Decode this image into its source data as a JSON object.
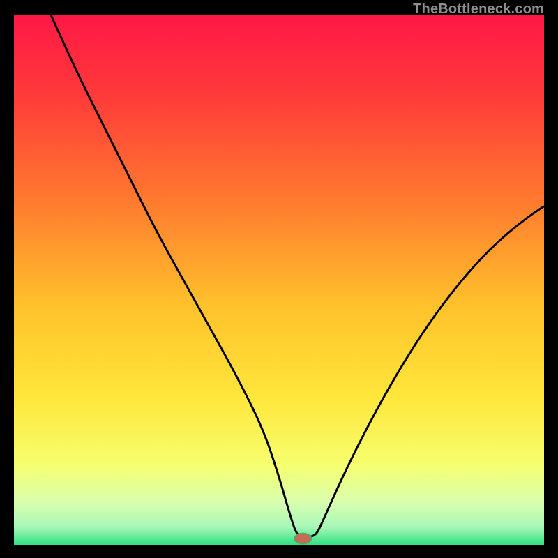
{
  "watermark": "TheBottleneck.com",
  "colors": {
    "frame": "#000000",
    "gradient_stops": [
      {
        "offset": 0.0,
        "color": "#ff1846"
      },
      {
        "offset": 0.15,
        "color": "#ff3a3a"
      },
      {
        "offset": 0.35,
        "color": "#ff7a2f"
      },
      {
        "offset": 0.55,
        "color": "#ffc22b"
      },
      {
        "offset": 0.72,
        "color": "#ffe63a"
      },
      {
        "offset": 0.85,
        "color": "#f6ff70"
      },
      {
        "offset": 0.92,
        "color": "#d8ffb0"
      },
      {
        "offset": 0.965,
        "color": "#a8f7b8"
      },
      {
        "offset": 1.0,
        "color": "#2be07e"
      }
    ],
    "curve": "#000000",
    "marker_fill": "#c86a58",
    "marker_stroke": "#38b764"
  },
  "chart_data": {
    "type": "line",
    "title": "",
    "xlabel": "",
    "ylabel": "",
    "xlim": [
      0,
      100
    ],
    "ylim": [
      0,
      100
    ],
    "series": [
      {
        "name": "bottleneck-curve",
        "x": [
          7,
          12,
          17,
          22,
          27,
          32,
          37,
          42,
          47,
          50,
          52,
          53.5,
          55.5,
          57,
          58,
          62,
          67,
          72,
          77,
          82,
          87,
          92,
          97,
          100
        ],
        "y": [
          100,
          89,
          79,
          69,
          59,
          50,
          41,
          32,
          22,
          13,
          6,
          1.5,
          1.5,
          2,
          4,
          13,
          23,
          32,
          40,
          47,
          53,
          58,
          62,
          64
        ]
      }
    ],
    "marker": {
      "x": 54.5,
      "y": 1.3,
      "rx": 1.6,
      "ry": 1.0
    }
  }
}
